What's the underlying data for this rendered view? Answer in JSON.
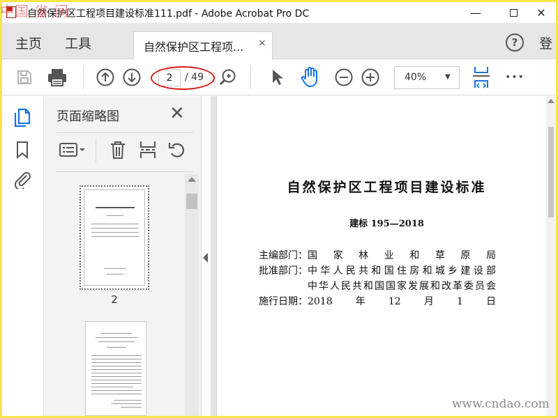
{
  "window": {
    "title": "自然保护区工程项目建设标准111.pdf - Adobe Acrobat Pro DC",
    "minimize_glyph": "—",
    "close_glyph": "✕"
  },
  "tabs": {
    "home": "主页",
    "tools": "工具",
    "document": "自然保护区工程项...",
    "document_close": "×",
    "help": "?",
    "login": "登"
  },
  "toolbar": {
    "page_current": "2",
    "page_total": "/ 49",
    "zoom": "40%",
    "more_glyph": "•••"
  },
  "thumbnails": {
    "title": "页面缩略图",
    "close_glyph": "✕",
    "page2_label": "2"
  },
  "document": {
    "title": "自然保护区工程项目建设标准",
    "code": "建标 195—2018",
    "rows": [
      {
        "label": "主编部门：",
        "value": "国家林业和草原局"
      },
      {
        "label": "批准部门：",
        "value": "中华人民共和国住房和城乡建设部"
      },
      {
        "label": "",
        "value": "中华人民共和国国家发展和改革委员会"
      },
      {
        "label": "施行日期：",
        "value": "2018年12月1日"
      }
    ]
  },
  "watermark": {
    "top": "中国 省 间",
    "bottom": "www.cndao.com"
  },
  "colors": {
    "accent_blue": "#1473e6",
    "highlight_red": "#e01818",
    "frame_yellow": "#f7e64a"
  }
}
